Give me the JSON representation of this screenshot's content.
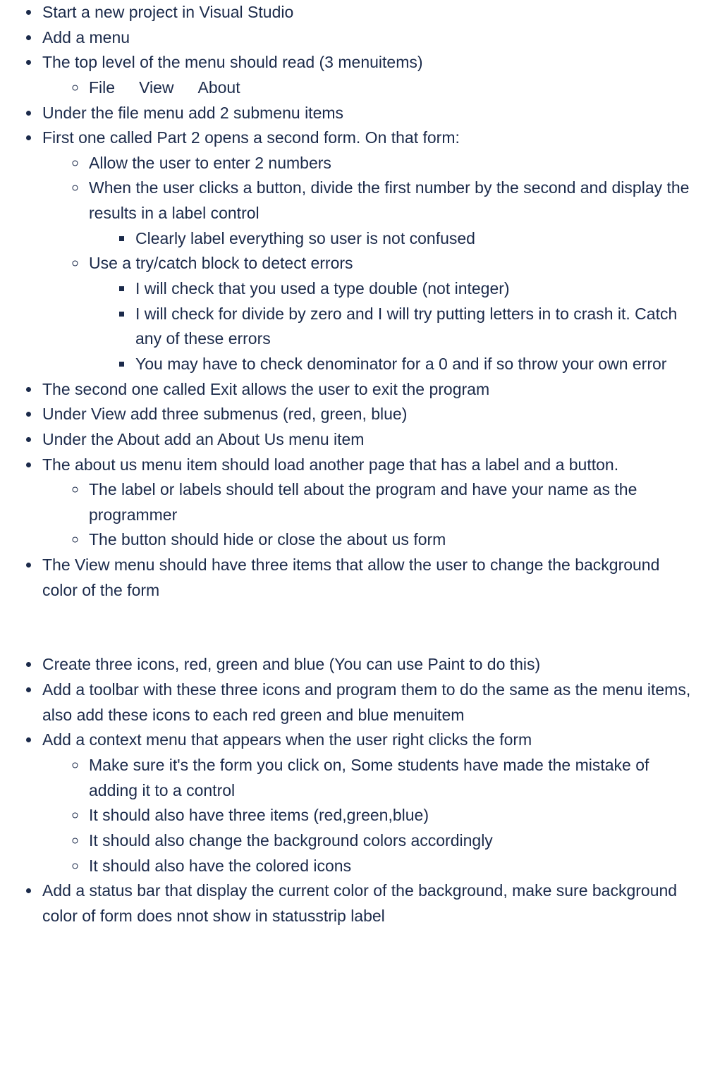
{
  "sectionA": {
    "items": [
      {
        "text": "Start a new project in Visual Studio"
      },
      {
        "text": "Add a menu"
      },
      {
        "text": "The top level of the menu should read (3 menuitems)",
        "sub": [
          {
            "inline": [
              "File",
              "View",
              "About"
            ]
          }
        ]
      },
      {
        "text": "Under the file menu add 2 submenu items"
      },
      {
        "text": "First one called Part 2 opens a second form. On that form:",
        "sub": [
          {
            "text": "Allow the user to enter 2 numbers"
          },
          {
            "text": "When the user clicks a button, divide the first number by the second and display the results in a label control",
            "sub": [
              {
                "text": "Clearly label everything so user is not confused"
              }
            ]
          },
          {
            "text": "Use a try/catch block to detect errors",
            "sub": [
              {
                "text": "I will check that you used a type double (not integer)"
              },
              {
                "text": "I will check for divide by zero and I will try putting letters in to crash it. Catch any of these errors"
              },
              {
                "text": "You may have to check denominator for a 0 and if so throw your own error"
              }
            ]
          }
        ]
      },
      {
        "text": "The second one called Exit allows the user to exit the program"
      },
      {
        "text": "Under View add three submenus (red, green, blue)"
      },
      {
        "text": "Under the About add an About Us menu item"
      },
      {
        "text": "The about us menu item should load another page that has a label and a button.",
        "sub": [
          {
            "text": "The label or labels should tell about the program and have your name as the programmer"
          },
          {
            "text": "The button should hide or close the about us form"
          }
        ]
      },
      {
        "text": "The View menu should have three items that allow the user to change the background color of the form"
      }
    ]
  },
  "sectionB": {
    "items": [
      {
        "text": "Create three icons, red, green and blue (You can use Paint to do this)"
      },
      {
        "text": "Add a toolbar with these three icons and program them to do the same as the menu items, also add these icons to each red green and blue menuitem"
      },
      {
        "text": "Add a context menu that appears when the user right clicks the form",
        "sub": [
          {
            "text": "Make sure it's the form you click on, Some students have made the mistake of adding it to a control"
          },
          {
            "text": "It should also have three items (red,green,blue)"
          },
          {
            "text": "It should also change the background colors accordingly"
          },
          {
            "text": "It should also have the colored icons"
          }
        ]
      },
      {
        "text": "Add a status bar that display the current color of the background, make sure background color of form does nnot show in statusstrip label"
      }
    ]
  }
}
